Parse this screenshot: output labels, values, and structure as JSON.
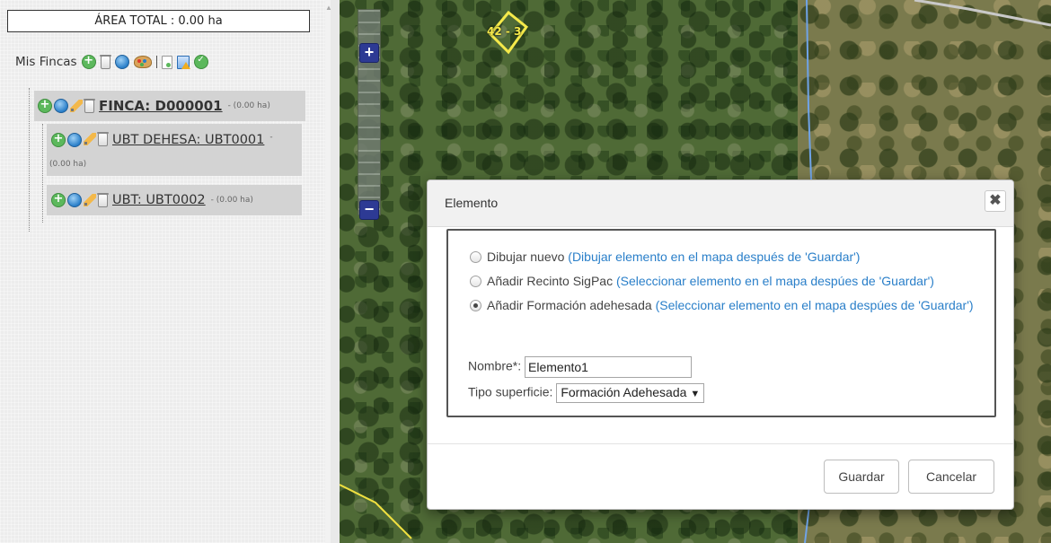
{
  "sidebar": {
    "area_total": "ÁREA TOTAL : 0.00 ha",
    "mis_fincas_label": "Mis Fincas",
    "toolbar_icons": [
      "add-icon",
      "delete-icon",
      "globe-icon",
      "palette-icon",
      "separator",
      "document-icon",
      "report-icon",
      "check-icon"
    ],
    "tree": [
      {
        "label": "FINCA: D000001",
        "area": "- (0.00 ha)",
        "level": 0
      },
      {
        "label": "UBT DEHESA: UBT0001",
        "area": "-",
        "area2": "(0.00 ha)",
        "level": 1
      },
      {
        "label": "UBT: UBT0002",
        "area": "- (0.00 ha)",
        "level": 1
      }
    ]
  },
  "map": {
    "parcel_label": "42 - 3",
    "zoom_in": "+",
    "zoom_out": "−"
  },
  "modal": {
    "title": "Elemento",
    "close": "✖",
    "options": [
      {
        "label": "Dibujar nuevo",
        "hint": "(Dibujar elemento en el mapa después de 'Guardar')",
        "selected": false
      },
      {
        "label": "Añadir Recinto SigPac",
        "hint": "(Seleccionar elemento en el mapa despúes de 'Guardar')",
        "selected": false
      },
      {
        "label": "Añadir Formación adehesada",
        "hint": "(Seleccionar elemento en el mapa despúes de 'Guardar')",
        "selected": true
      }
    ],
    "nombre_label": "Nombre*:",
    "nombre_value": "Elemento1",
    "tipo_label": "Tipo superficie:",
    "tipo_value": "Formación Adehesada",
    "tipo_arrow": "▼",
    "guardar": "Guardar",
    "cancelar": "Cancelar"
  },
  "colors": {
    "link_blue": "#2a7fc9",
    "zoom_blue": "#2d3a94",
    "parcel_yellow": "#f5e94a"
  }
}
